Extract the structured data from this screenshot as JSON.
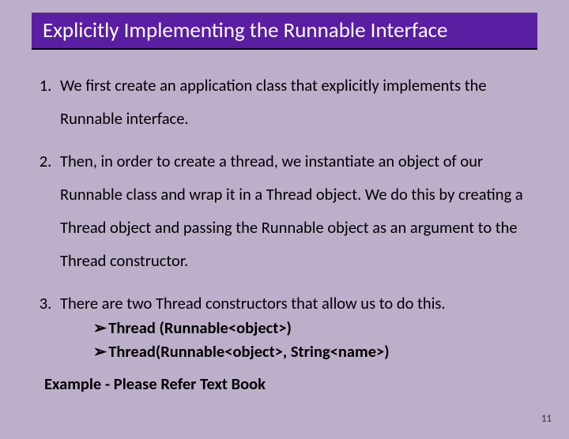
{
  "title": "Explicitly Implementing the Runnable Interface",
  "items": [
    {
      "text": "We first create an application class that explicitly implements the Runnable interface."
    },
    {
      "text": "Then, in order to create a thread, we instantiate an object of our Runnable class and wrap it in a Thread object. We do this by creating a Thread object and passing the Runnable object as an argument to the Thread constructor."
    },
    {
      "text": "There are two Thread constructors that allow us to do this."
    }
  ],
  "sub": [
    "Thread (Runnable<object>)",
    "Thread(Runnable<object>, String<name>)"
  ],
  "example": "Example -  Please Refer Text Book",
  "page": "11"
}
